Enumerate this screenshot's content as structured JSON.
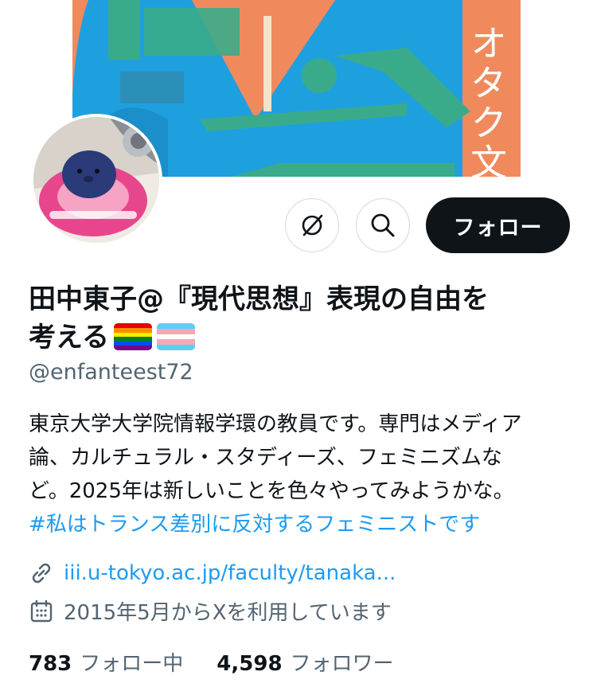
{
  "profile": {
    "name_line1": "田中東子@『現代思想』表現の自由を",
    "name_line2": "考える",
    "flags": [
      "rainbow-flag",
      "transgender-flag"
    ],
    "handle": "@enfanteest72",
    "bio_lines": [
      "東京大学大学院情報学環の教員です。専門はメディア",
      "論、カルチュラル・スタディーズ、フェミニズムな",
      "ど。2025年は新しいことを色々やってみようかな。"
    ],
    "hashtag": "#私はトランス差別に反対するフェミニストです",
    "website": "iii.u-tokyo.ac.jp/faculty/tanaka...",
    "joined": "2015年5月からXを利用しています",
    "following_count": "783",
    "following_label": "フォロー中",
    "followers_count": "4,598",
    "followers_label": "フォロワー"
  },
  "banner": {
    "text_visible": "オタク文化"
  },
  "actions": {
    "grok_icon": "grok-icon",
    "search_icon": "search-icon",
    "follow_label": "フォロー"
  },
  "colors": {
    "accent": "#1d9bf0",
    "text": "#0f1419",
    "muted": "#536471",
    "banner_orange": "#f08a5d",
    "banner_blue": "#1fa0de",
    "banner_green": "#3aab8a"
  }
}
